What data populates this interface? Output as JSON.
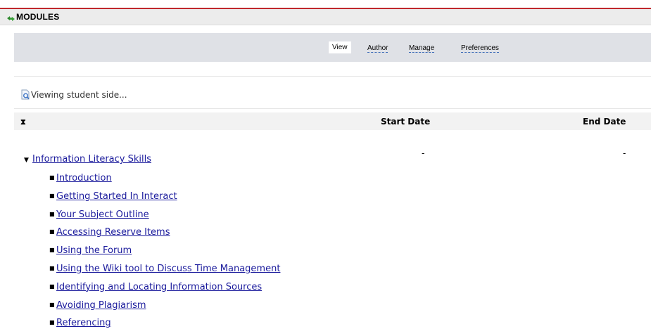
{
  "header": {
    "title": "MODULES",
    "icon": "refresh-arrows-icon"
  },
  "nav": {
    "tabs": [
      {
        "label": "View",
        "active": true
      },
      {
        "label": "Author",
        "active": false
      },
      {
        "label": "Manage",
        "active": false
      },
      {
        "label": "Preferences",
        "active": false
      }
    ]
  },
  "status": {
    "text": "Viewing student side...",
    "icon": "magnifier-page-icon"
  },
  "table": {
    "columns": {
      "sort_icon": "⧗",
      "start": "Start Date",
      "end": "End Date"
    },
    "root": {
      "label": "Information Literacy Skills",
      "start": "-",
      "end": "-"
    },
    "items": [
      "Introduction",
      "Getting Started In Interact",
      "Your Subject Outline",
      "Accessing Reserve Items",
      "Using the Forum",
      "Using the Wiki tool to Discuss Time Management",
      "Identifying and Locating Information Sources",
      "Avoiding Plagiarism",
      "Referencing"
    ]
  },
  "colors": {
    "accent_line": "#c0282d",
    "link": "#1a1a9c",
    "nav_bg": "#dfe1e6"
  }
}
